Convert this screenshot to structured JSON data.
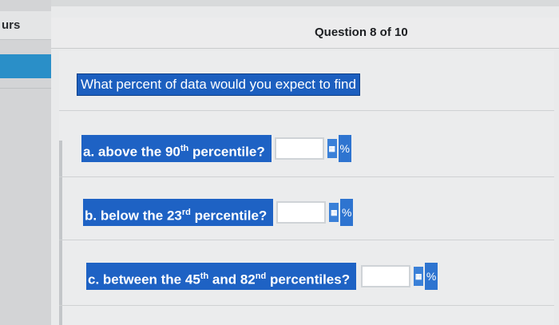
{
  "sidebar": {
    "title": "urs"
  },
  "header": {
    "question_counter": "Question 8 of 10"
  },
  "question": {
    "prompt": "What percent of data would you expect to find"
  },
  "parts": [
    {
      "prefix": "a. above the 90",
      "sup": "th",
      "suffix": " percentile?",
      "value": "",
      "unit": "%"
    },
    {
      "prefix": "b. below the 23",
      "sup": "rd",
      "suffix": " percentile?",
      "value": "",
      "unit": "%"
    },
    {
      "prefix": "c. between the 45",
      "sup": "th",
      "mid": " and 82",
      "sup2": "nd",
      "suffix": " percentiles?",
      "value": "",
      "unit": "%"
    }
  ],
  "icons": {
    "field_button": "math-input-icon"
  }
}
